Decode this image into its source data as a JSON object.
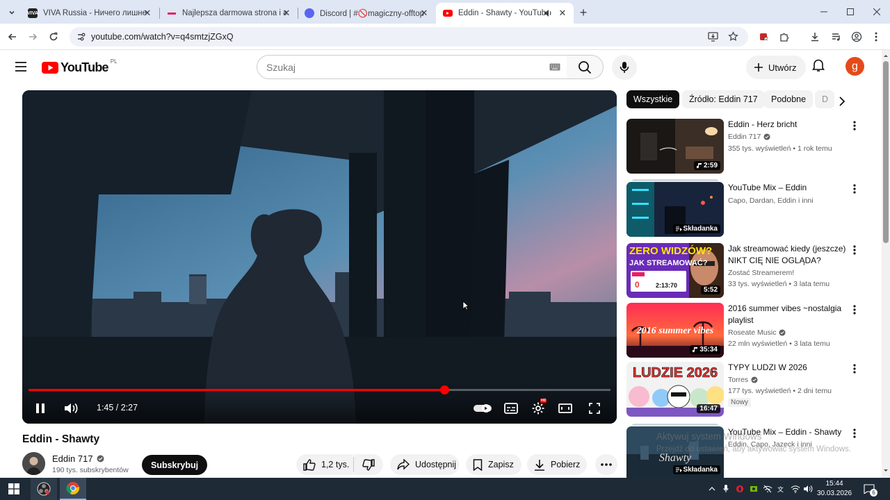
{
  "browser": {
    "tabs": [
      {
        "title": "VIVA Russia - Ничего лишнего",
        "favicon": "viva-favicon",
        "active": false
      },
      {
        "title": "Najlepsza darmowa strona i apl",
        "favicon": "pink-line-favicon",
        "active": false
      },
      {
        "title": "Discord | #🚫magiczny-offtop",
        "favicon": "discord-favicon",
        "active": false
      },
      {
        "title": "Eddin - Shawty - YouTube",
        "favicon": "youtube-favicon",
        "active": true
      }
    ],
    "url": "youtube.com/watch?v=q4smtzjZGxQ",
    "extensions_badge": "32"
  },
  "youtube": {
    "logo_text": "YouTube",
    "country_code": "PL",
    "search_placeholder": "Szukaj",
    "create_label": "Utwórz",
    "avatar_letter": "g",
    "accent_color": "#ff0000"
  },
  "player": {
    "current_time": "1:45",
    "duration": "2:27",
    "time_display": "1:45 / 2:27",
    "progress_fraction": 0.714,
    "settings_badge": "HD",
    "state": "playing"
  },
  "video": {
    "title": "Eddin - Shawty",
    "channel": "Eddin 717",
    "verified": true,
    "subscribers": "190 tys. subskrybentów",
    "subscribe_label": "Subskrybuj",
    "likes": "1,2 tys.",
    "share_label": "Udostępnij",
    "save_label": "Zapisz",
    "download_label": "Pobierz"
  },
  "chips": [
    "Wszystkie",
    "Źródło: Eddin 717",
    "Podobne",
    "D"
  ],
  "recommendations": [
    {
      "title": "Eddin - Herz bricht",
      "channel": "Eddin 717",
      "verified": true,
      "meta": "355 tys. wyświetleń • 1 rok temu",
      "badge": "2:59",
      "badge_icon": "music-note-icon"
    },
    {
      "title": "YouTube Mix – Eddin",
      "channel": "Capo, Dardan, Eddin i inni",
      "verified": false,
      "meta": "",
      "badge": "Składanka",
      "badge_icon": "mix-icon"
    },
    {
      "title": "Jak streamować kiedy (jeszcze) NIKT CIĘ NIE OGLĄDA?",
      "channel": "Zostać Streamerem!",
      "verified": false,
      "meta": "33 tys. wyświetleń • 3 lata temu",
      "badge": "5:52",
      "badge_icon": ""
    },
    {
      "title": "2016 summer vibes ~nostalgia playlist",
      "channel": "Roseate Music",
      "verified": true,
      "meta": "22 mln wyświetleń • 3 lata temu",
      "badge": "35:34",
      "badge_icon": "music-note-icon"
    },
    {
      "title": "TYPY LUDZI W 2026",
      "channel": "Torres",
      "verified": true,
      "meta": "177 tys. wyświetleń • 2 dni temu",
      "badge": "16:47",
      "badge_icon": "",
      "new_label": "Nowy"
    },
    {
      "title": "YouTube Mix – Eddin - Shawty",
      "channel": "Eddin, Capo, Jazeck i inni",
      "verified": false,
      "meta": "",
      "badge": "Składanka",
      "badge_icon": "mix-icon"
    }
  ],
  "thumbnail_texts": {
    "rec3_top": "ZERO WIDZÓW?",
    "rec3_bottom": "JAK STREAMOWAĆ?",
    "rec3_counter": "0",
    "rec3_timer": "2:13:70",
    "rec4_text": "2016 summer vibes",
    "rec5_text": "LUDZIE 2026",
    "rec6_text": "Shawty"
  },
  "watermark": {
    "line1": "Aktywuj system Windows",
    "line2": "Przejdź do ustawień, aby aktywować system Windows."
  },
  "taskbar": {
    "time": "15:44",
    "date": "30.03.2026",
    "notifications": "6"
  }
}
